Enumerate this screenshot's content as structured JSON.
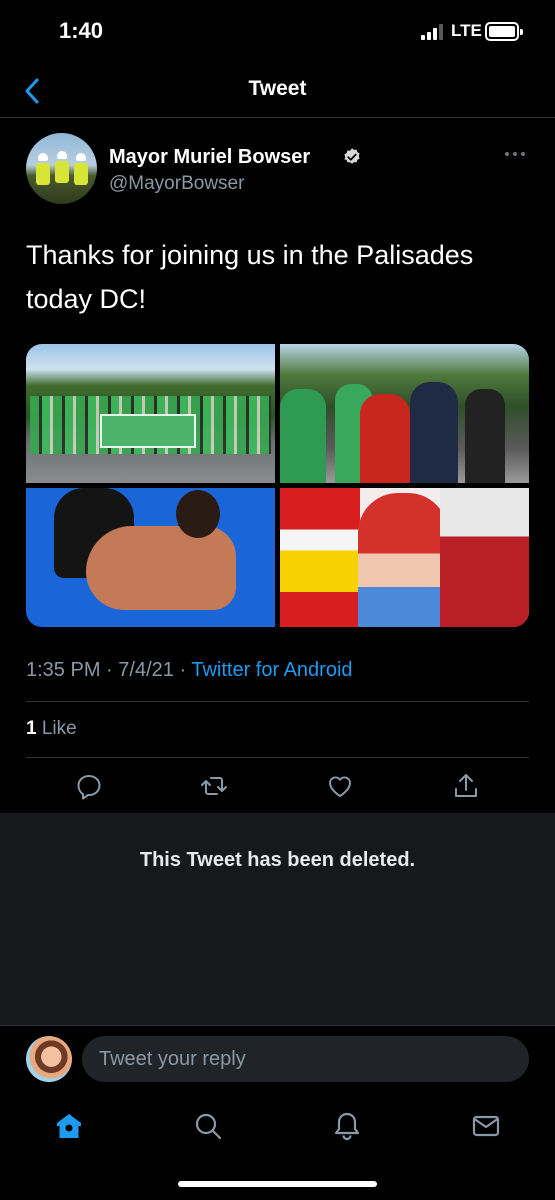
{
  "status_bar": {
    "time": "1:40",
    "network": "LTE"
  },
  "nav": {
    "title": "Tweet",
    "back_icon": "chevron-left-icon"
  },
  "author": {
    "name": "Mayor Muriel Bowser",
    "handle": "@MayorBowser",
    "verified": true
  },
  "tweet": {
    "text": "Thanks for joining us in the Palisades today DC!",
    "media_count": 4,
    "time": "1:35 PM",
    "date": "7/4/21",
    "sep1": "·",
    "sep2": "·",
    "source": "Twitter for Android"
  },
  "stats": {
    "like_count": "1",
    "like_label": "Like"
  },
  "actions": [
    "reply-icon",
    "retweet-icon",
    "like-icon",
    "share-icon"
  ],
  "quoted": {
    "deleted_text": "This Tweet has been deleted."
  },
  "reply": {
    "placeholder": "Tweet your reply"
  },
  "tabs": [
    "home-icon",
    "search-icon",
    "notifications-icon",
    "messages-icon"
  ],
  "colors": {
    "accent": "#1d9bf0",
    "background": "#000000",
    "panel": "#16181c",
    "muted": "#8b98a5"
  }
}
